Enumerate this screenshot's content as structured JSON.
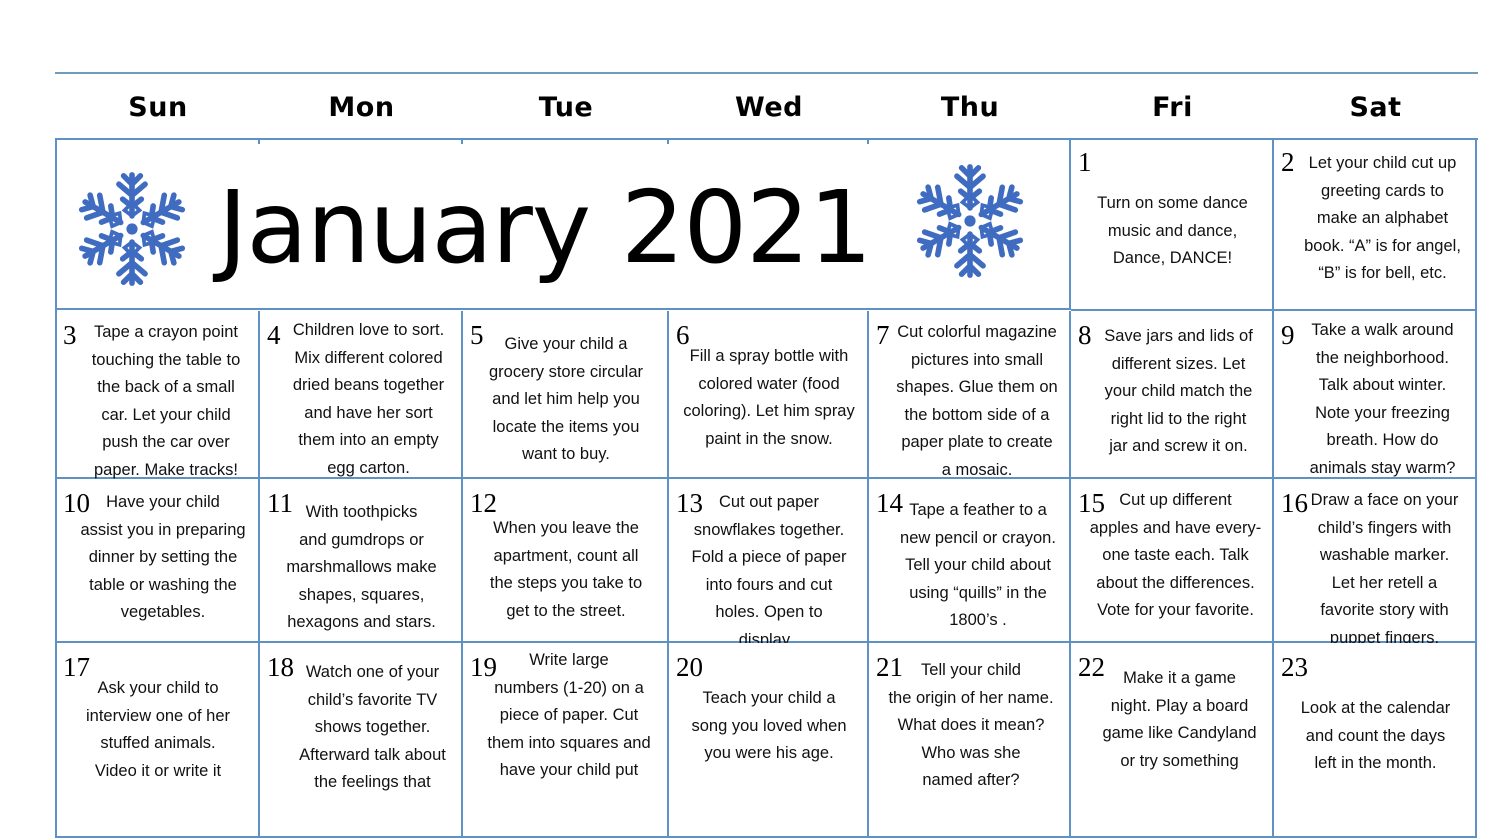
{
  "calendar": {
    "month_title": "January 2021",
    "accent_color": "#5e92c4",
    "snowflake_color": "#3f6cc0",
    "weekdays": [
      "Sun",
      "Mon",
      "Tue",
      "Wed",
      "Thu",
      "Fri",
      "Sat"
    ],
    "days": [
      {
        "num": "1",
        "text": "Turn on some dance\nmusic and dance,\nDance, DANCE!"
      },
      {
        "num": "2",
        "text": "Let your child cut up\ngreeting cards to\nmake an alphabet\nbook. “A” is for angel,\n“B” is for bell, etc."
      },
      {
        "num": "3",
        "text": "Tape a crayon point\ntouching the table to\nthe back of a small\ncar. Let your child\npush the car over\npaper.  Make tracks!"
      },
      {
        "num": "4",
        "text": "Children love to sort.\nMix different colored\ndried beans together\nand have her sort\nthem into an empty\negg carton."
      },
      {
        "num": "5",
        "text": "Give your child a\ngrocery store circular\nand let him help you\nlocate the items you\nwant to buy."
      },
      {
        "num": "6",
        "text": "Fill a spray bottle with\ncolored water (food\ncoloring). Let him spray\npaint in the snow."
      },
      {
        "num": "7",
        "text": "Cut colorful magazine\npictures into small\nshapes. Glue them on\nthe bottom side of a\npaper plate to create\na mosaic."
      },
      {
        "num": "8",
        "text": "Save jars and lids of\ndifferent sizes. Let\nyour child match the\nright lid to the right\njar and screw it on."
      },
      {
        "num": "9",
        "text": "Take a walk around\nthe neighborhood.\nTalk about winter.\nNote your freezing\nbreath. How do\nanimals stay warm?"
      },
      {
        "num": "10",
        "text": "Have your child\nassist you in preparing\ndinner by setting the\ntable or washing the\nvegetables."
      },
      {
        "num": "11",
        "text": "With toothpicks\nand gumdrops or\nmarshmallows make\nshapes, squares,\nhexagons and stars."
      },
      {
        "num": "12",
        "text": "When you leave the\napartment, count all\nthe steps you take to\nget to the street."
      },
      {
        "num": "13",
        "text": "Cut out paper\nsnowflakes together.\nFold a piece of paper\ninto fours and cut\nholes. Open to\ndisplay ."
      },
      {
        "num": "14",
        "text": "Tape a feather to a\nnew pencil or crayon.\nTell your child about\nusing “quills” in the\n1800’s ."
      },
      {
        "num": "15",
        "text": "Cut up different\napples and have every-\none taste each. Talk\nabout the differences.\nVote for your favorite."
      },
      {
        "num": "16",
        "text": "Draw a face on your\nchild’s fingers with\nwashable marker.\nLet her retell a\nfavorite story with\npuppet fingers."
      },
      {
        "num": "17",
        "text": "Ask your child to\ninterview one of her\nstuffed animals.\nVideo it or write it"
      },
      {
        "num": "18",
        "text": "Watch one of your\nchild’s favorite TV\nshows together.\nAfterward talk about\nthe feelings that"
      },
      {
        "num": "19",
        "text": "Write large\nnumbers (1-20) on a\npiece of paper. Cut\nthem into squares and\nhave your child put"
      },
      {
        "num": "20",
        "text": "Teach your child a\nsong you loved when\nyou were his age."
      },
      {
        "num": "21",
        "text": "Tell your child\nthe origin of her name.\nWhat does it mean?\nWho was she\nnamed after?"
      },
      {
        "num": "22",
        "text": "Make it a game\nnight. Play a board\ngame like Candyland\nor try something"
      },
      {
        "num": "23",
        "text": "Look at the calendar\nand count the days\nleft in the month."
      }
    ]
  }
}
